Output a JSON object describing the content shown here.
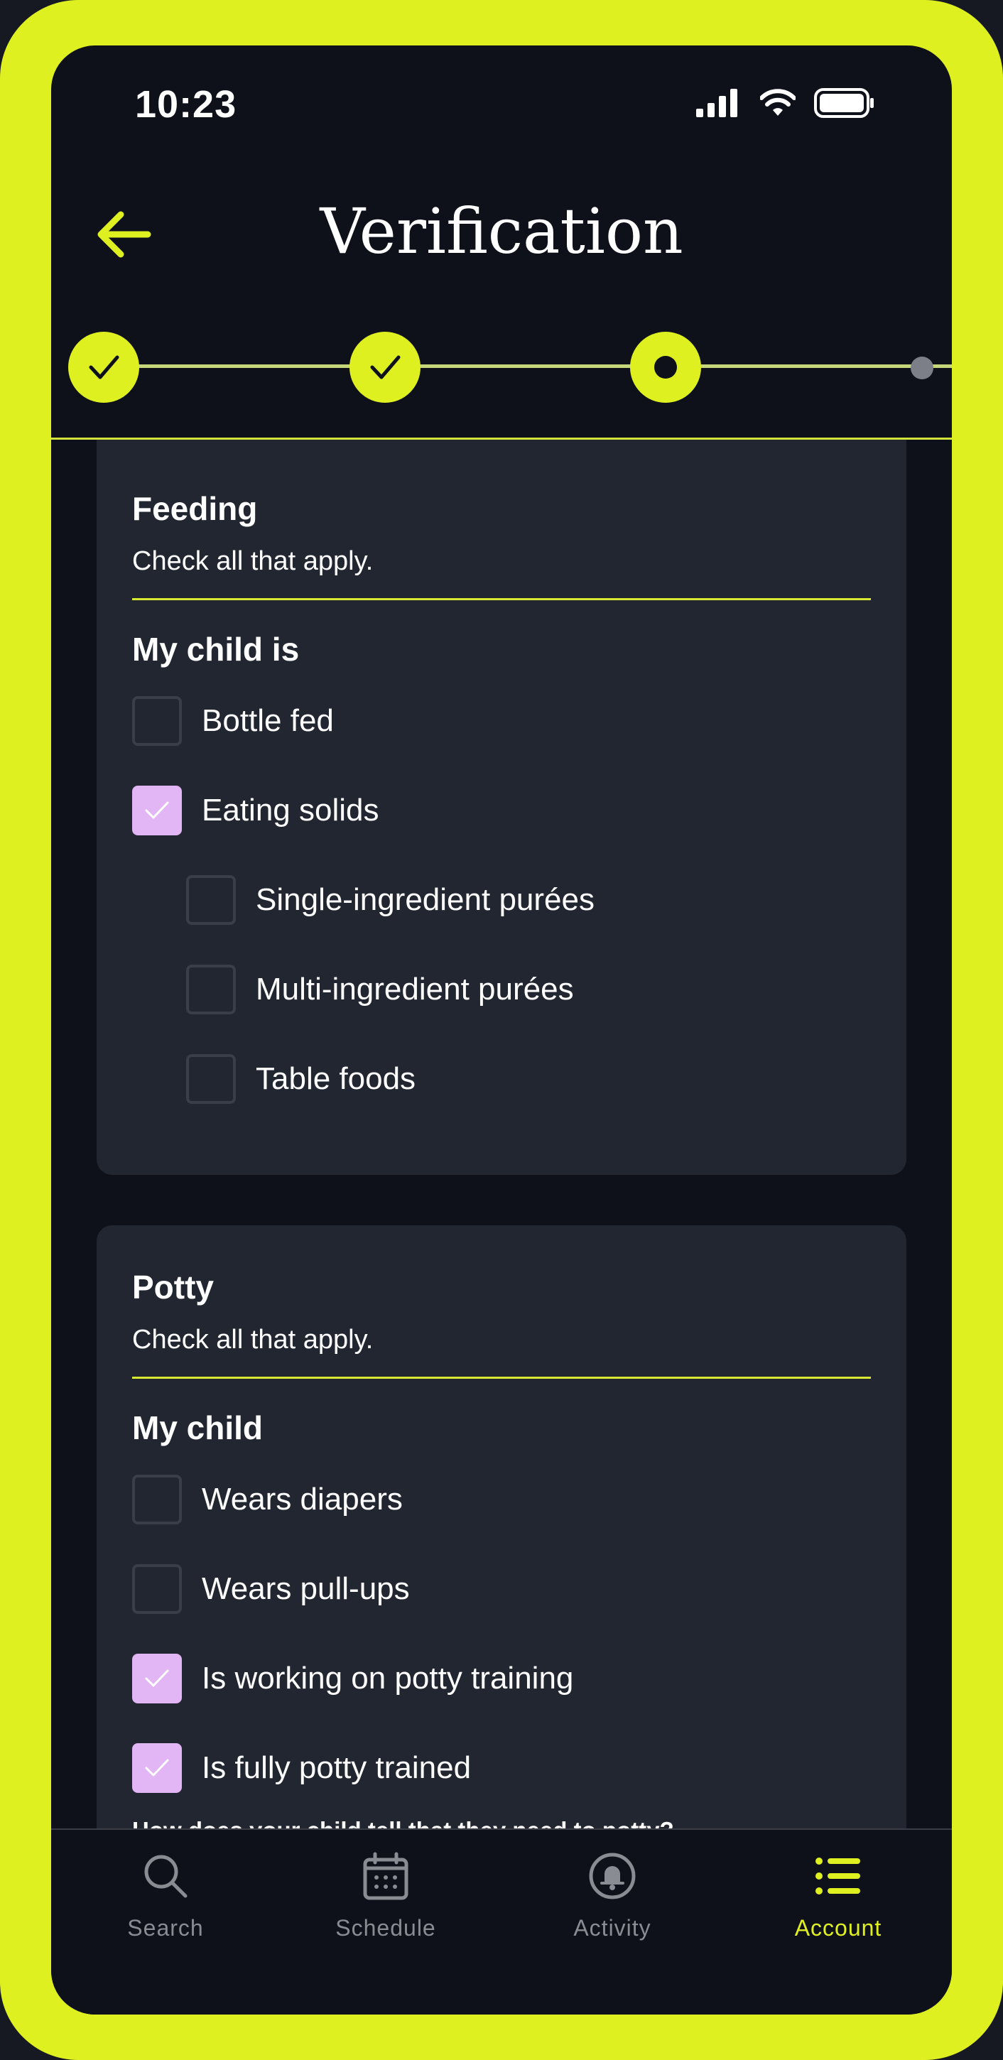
{
  "status_bar": {
    "time": "10:23"
  },
  "header": {
    "title": "Verification"
  },
  "stepper": {
    "total_steps": 4,
    "completed_steps": 2,
    "current_step": 3
  },
  "feeding": {
    "title": "Feeding",
    "subtitle": "Check all that apply.",
    "group_label": "My child is",
    "options": [
      {
        "label": "Bottle fed",
        "checked": false
      },
      {
        "label": "Eating solids",
        "checked": true
      },
      {
        "label": "Single-ingredient purées",
        "checked": false
      },
      {
        "label": "Multi-ingredient purées",
        "checked": false
      },
      {
        "label": "Table foods",
        "checked": false
      }
    ]
  },
  "potty": {
    "title": "Potty",
    "subtitle": "Check all that apply.",
    "group_label": "My child",
    "options": [
      {
        "label": "Wears diapers",
        "checked": false
      },
      {
        "label": "Wears pull-ups",
        "checked": false
      },
      {
        "label": "Is working on potty training",
        "checked": true
      },
      {
        "label": "Is fully potty trained",
        "checked": true
      }
    ],
    "question": "How does your child tell that they need to potty?"
  },
  "nav": {
    "items": [
      {
        "label": "Search",
        "icon": "search-icon",
        "active": false
      },
      {
        "label": "Schedule",
        "icon": "calendar-icon",
        "active": false
      },
      {
        "label": "Activity",
        "icon": "bell-icon",
        "active": false
      },
      {
        "label": "Account",
        "icon": "list-icon",
        "active": true
      }
    ]
  },
  "colors": {
    "accent": "#dff021",
    "checked": "#e2b6f4",
    "background": "#0e101a",
    "card": "#222630"
  }
}
